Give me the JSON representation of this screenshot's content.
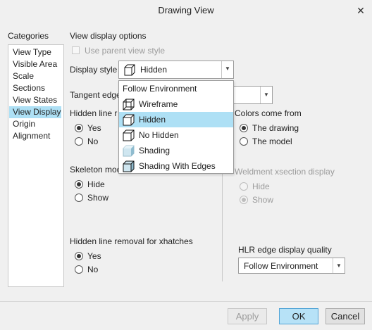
{
  "window": {
    "title": "Drawing View",
    "close_glyph": "✕"
  },
  "categories": {
    "heading": "Categories",
    "items": [
      {
        "label": "View Type"
      },
      {
        "label": "Visible Area"
      },
      {
        "label": "Scale"
      },
      {
        "label": "Sections"
      },
      {
        "label": "View States"
      },
      {
        "label": "View Display",
        "selected": true
      },
      {
        "label": "Origin"
      },
      {
        "label": "Alignment"
      }
    ]
  },
  "view_display": {
    "heading": "View display options",
    "use_parent_style": {
      "label": "Use parent view style",
      "checked": false,
      "enabled": false
    },
    "display_style": {
      "label": "Display style",
      "value": "Hidden",
      "icon": "hidden-cube-icon",
      "options": [
        {
          "label": "Follow Environment",
          "icon": ""
        },
        {
          "label": "Wireframe",
          "icon": "wireframe-cube-icon"
        },
        {
          "label": "Hidden",
          "icon": "hidden-cube-icon",
          "highlighted": true
        },
        {
          "label": "No Hidden",
          "icon": "no-hidden-cube-icon"
        },
        {
          "label": "Shading",
          "icon": "shading-cube-icon"
        },
        {
          "label": "Shading With Edges",
          "icon": "shading-edges-cube-icon"
        }
      ]
    },
    "tangent_edges": {
      "label": "Tangent edge"
    },
    "hidden_line_removal": {
      "label": "Hidden line r",
      "options": [
        {
          "label": "Yes",
          "selected": true
        },
        {
          "label": "No",
          "selected": false
        }
      ]
    },
    "skeleton_model": {
      "label": "Skeleton mod",
      "options": [
        {
          "label": "Hide",
          "selected": true
        },
        {
          "label": "Show",
          "selected": false
        }
      ]
    },
    "hlr_xhatches": {
      "label": "Hidden line removal for xhatches",
      "options": [
        {
          "label": "Yes",
          "selected": true
        },
        {
          "label": "No",
          "selected": false
        }
      ]
    },
    "colors_come_from": {
      "label": "Colors come from",
      "options": [
        {
          "label": "The drawing",
          "selected": true
        },
        {
          "label": "The model",
          "selected": false
        }
      ]
    },
    "weldment_xsection": {
      "label": "Weldment xsection display",
      "enabled": false,
      "options": [
        {
          "label": "Hide",
          "selected": false
        },
        {
          "label": "Show",
          "selected": true
        }
      ]
    },
    "hlr_edge_quality": {
      "label": "HLR edge display quality",
      "value": "Follow Environment"
    }
  },
  "buttons": {
    "apply": "Apply",
    "ok": "OK",
    "cancel": "Cancel"
  },
  "colors": {
    "selection": "#aee0f5",
    "primary_button": "#b7e2f7",
    "primary_border": "#4fa3d6"
  }
}
